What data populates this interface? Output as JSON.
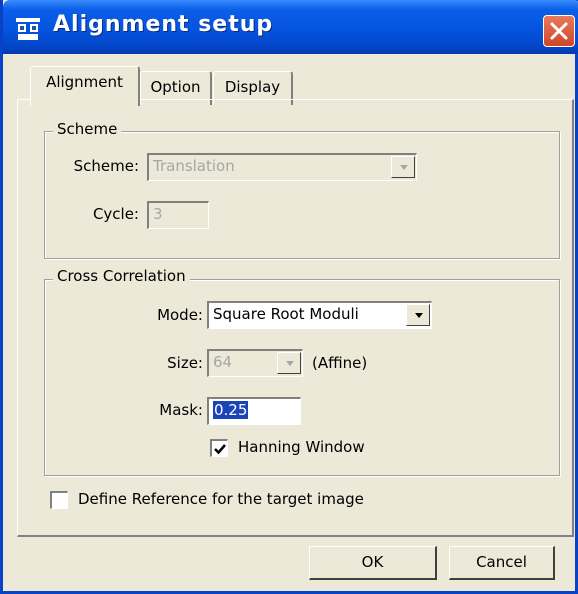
{
  "window": {
    "title": "Alignment setup"
  },
  "tabs": [
    {
      "label": "Alignment",
      "active": true
    },
    {
      "label": "Option",
      "active": false
    },
    {
      "label": "Display",
      "active": false
    }
  ],
  "scheme_group": {
    "legend": "Scheme",
    "scheme_label": "Scheme:",
    "scheme_value": "Translation",
    "cycle_label": "Cycle:",
    "cycle_value": "3"
  },
  "cross_correlation": {
    "legend": "Cross Correlation",
    "mode_label": "Mode:",
    "mode_value": "Square Root Moduli",
    "size_label": "Size:",
    "size_value": "64",
    "size_note": "(Affine)",
    "mask_label": "Mask:",
    "mask_value": "0.25",
    "hanning_label": "Hanning Window",
    "hanning_checked": true
  },
  "define_reference": {
    "label": "Define Reference for the target image",
    "checked": false
  },
  "buttons": {
    "ok": "OK",
    "cancel": "Cancel"
  },
  "colors": {
    "titlebar": "#0553e0",
    "face": "#ece9d8",
    "selection": "#1b44b8",
    "close": "#d0462a"
  }
}
